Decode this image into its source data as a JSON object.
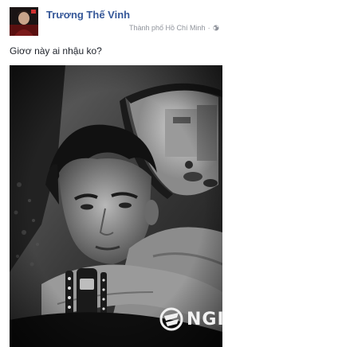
{
  "post": {
    "author": {
      "name": "Trương Thế Vinh",
      "avatar_icon": "user-avatar"
    },
    "meta": {
      "location": "Thành phố Hồ Chí Minh",
      "separator": "·",
      "privacy_icon": "globe-icon"
    },
    "text": "Giơơ này ai nhậu ko?",
    "photo": {
      "watermark_text": "NGI",
      "style": "black-and-white"
    }
  }
}
